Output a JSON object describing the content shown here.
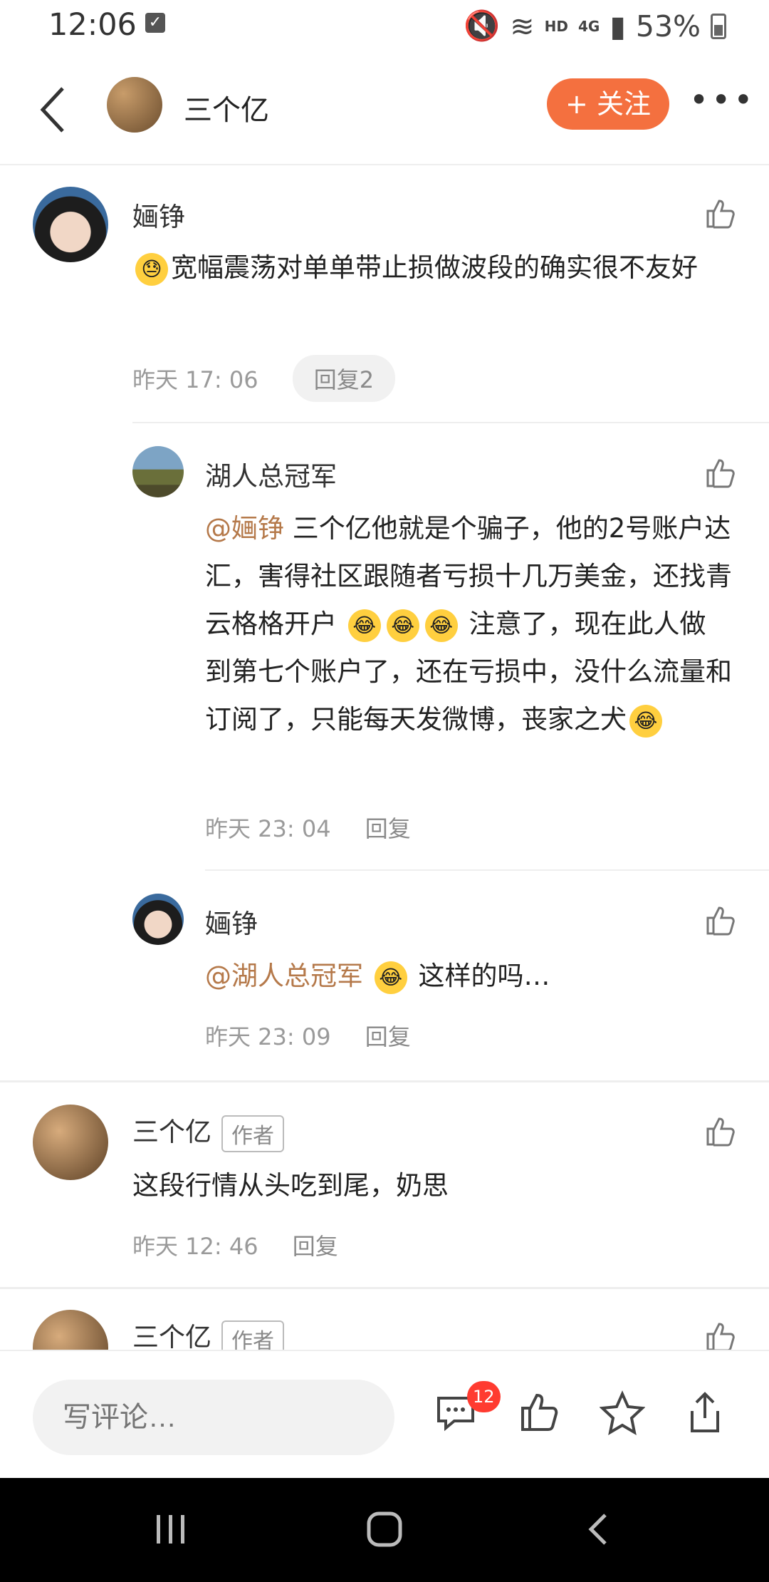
{
  "status": {
    "time": "12:06",
    "hd": "HD",
    "network": "4G",
    "battery": "53%"
  },
  "header": {
    "title": "三个亿",
    "follow_label": "+ 关注",
    "more_label": "•••"
  },
  "comments": [
    {
      "name": "婳铮",
      "emoji": "😓",
      "text": "宽幅震荡对单单带止损做波段的确实很不友好",
      "time": "昨天 17: 06",
      "reply_label": "回复2"
    },
    {
      "name": "湖人总冠军",
      "mention": "@婳铮",
      "text_a": "三个亿他就是个骗子，他的2号账户达汇，害得社区跟随者亏损十几万美金，还找青云格格开户",
      "emoji": "😂",
      "text_b": "注意了，现在此人做到第七个账户了，还在亏损中，没什么流量和订阅了，只能每天发微博，丧家之犬",
      "time": "昨天 23: 04",
      "reply_label": "回复"
    },
    {
      "name": "婳铮",
      "mention": "@湖人总冠军",
      "emoji": "😂",
      "text": "这样的吗…",
      "time": "昨天 23: 09",
      "reply_label": "回复"
    },
    {
      "name": "三个亿",
      "badge": "作者",
      "text": "这段行情从头吃到尾，奶思",
      "time": "昨天 12: 46",
      "reply_label": "回复"
    },
    {
      "name": "三个亿",
      "badge": "作者"
    }
  ],
  "bottom": {
    "placeholder": "写评论…",
    "comment_count": "12"
  },
  "colors": {
    "accent": "#f4703f",
    "mention": "#b5794a",
    "badge": "#ff3b30"
  }
}
